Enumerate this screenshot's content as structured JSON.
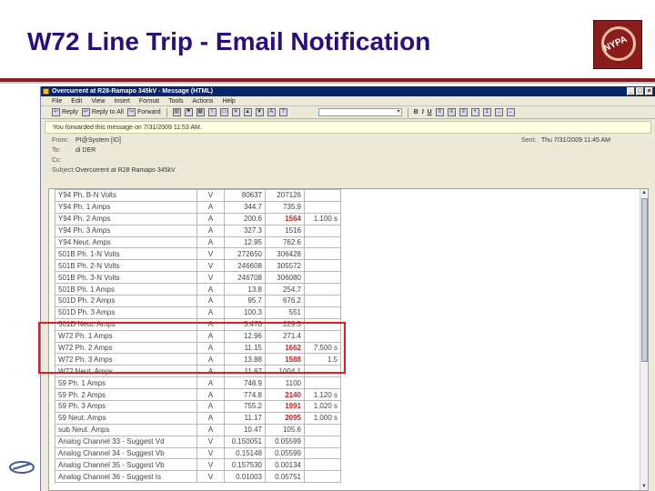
{
  "slide": {
    "title": "W72 Line Trip - Email Notification",
    "logo_text": "NYPA"
  },
  "window": {
    "title": "Overcurrent at R28-Ramapo 345kV - Message (HTML)"
  },
  "menu": [
    "File",
    "Edit",
    "View",
    "Insert",
    "Format",
    "Tools",
    "Actions",
    "Help"
  ],
  "toolbar": {
    "reply": "Reply",
    "reply_all": "Reply to All",
    "forward": "Forward"
  },
  "infobar": {
    "text": "You forwarded this message on 7/31/2009 11:53 AM."
  },
  "headers": {
    "from_label": "From:",
    "from_value": "PI@System [ID]",
    "to_label": "To:",
    "to_value": "di DER",
    "cc_label": "Cc:",
    "cc_value": "",
    "subject_label": "Subject:",
    "subject_value": "Overcurrent at R28 Ramapo 345kV",
    "sent_label": "Sent:",
    "sent_value": "Thu 7/31/2009 11:45 AM"
  },
  "table": {
    "rows": [
      {
        "name": "Y94 Ph. B-N Volts",
        "unit": "V",
        "v1": "80637",
        "v2": "207126",
        "v3": "",
        "red": false
      },
      {
        "name": "Y94 Ph. 1 Amps",
        "unit": "A",
        "v1": "344.7",
        "v2": "735.9",
        "v3": "",
        "red": false
      },
      {
        "name": "Y94 Ph. 2 Amps",
        "unit": "A",
        "v1": "200.6",
        "v2": "1564",
        "v3": "1.100 s",
        "red": true
      },
      {
        "name": "Y94 Ph. 3 Amps",
        "unit": "A",
        "v1": "327.3",
        "v2": "1516",
        "v3": "",
        "red": false
      },
      {
        "name": "Y94 Neut. Amps",
        "unit": "A",
        "v1": "12.95",
        "v2": "762.6",
        "v3": "",
        "red": false
      },
      {
        "name": "501B Ph. 1-N Volts",
        "unit": "V",
        "v1": "272650",
        "v2": "306428",
        "v3": "",
        "red": false
      },
      {
        "name": "501B Ph. 2-N Volts",
        "unit": "V",
        "v1": "246608",
        "v2": "305572",
        "v3": "",
        "red": false
      },
      {
        "name": "501B Ph. 3-N Volts",
        "unit": "V",
        "v1": "246708",
        "v2": "306080",
        "v3": "",
        "red": false
      },
      {
        "name": "501B Ph. 1 Amps",
        "unit": "A",
        "v1": "13.8",
        "v2": "254.7",
        "v3": "",
        "red": false
      },
      {
        "name": "501D Ph. 2 Amps",
        "unit": "A",
        "v1": "95.7",
        "v2": "676.2",
        "v3": "",
        "red": false
      },
      {
        "name": "501D Ph. 3 Amps",
        "unit": "A",
        "v1": "100.3",
        "v2": "551",
        "v3": "",
        "red": false
      },
      {
        "name": "501D Neut. Amps",
        "unit": "A",
        "v1": "5.470",
        "v2": "229.5",
        "v3": "",
        "red": false
      },
      {
        "name": "W72 Ph. 1 Amps",
        "unit": "A",
        "v1": "12.96",
        "v2": "271.4",
        "v3": "",
        "red": false
      },
      {
        "name": "W72 Ph. 2 Amps",
        "unit": "A",
        "v1": "11.15",
        "v2": "1662",
        "v3": "7.500 s",
        "red": true
      },
      {
        "name": "W72 Ph. 3 Amps",
        "unit": "A",
        "v1": "13.88",
        "v2": "1588",
        "v3": "1.5",
        "red": true
      },
      {
        "name": "W72 Neut. Amps",
        "unit": "A",
        "v1": "11.67",
        "v2": "1004.1",
        "v3": "",
        "red": false
      },
      {
        "name": "59 Ph. 1 Amps",
        "unit": "A",
        "v1": "748.9",
        "v2": "1100",
        "v3": "",
        "red": false
      },
      {
        "name": "59 Ph. 2 Amps",
        "unit": "A",
        "v1": "774.8",
        "v2": "2140",
        "v3": "1.120 s",
        "red": true
      },
      {
        "name": "59 Ph. 3 Amps",
        "unit": "A",
        "v1": "755.2",
        "v2": "1991",
        "v3": "1.020 s",
        "red": true
      },
      {
        "name": "59 Neut. Amps",
        "unit": "A",
        "v1": "11.17",
        "v2": "2095",
        "v3": "1.000 s",
        "red": true
      },
      {
        "name": "sub Neut. Amps",
        "unit": "A",
        "v1": "10.47",
        "v2": "105.6",
        "v3": "",
        "red": false
      },
      {
        "name": "Analog Channel 33 - Suggest Vd",
        "unit": "V",
        "v1": "0.150051",
        "v2": "0.05599",
        "v3": "",
        "red": false
      },
      {
        "name": "Analog Channel 34 - Suggest Vb",
        "unit": "V",
        "v1": "0.15148",
        "v2": "0.05599",
        "v3": "",
        "red": false
      },
      {
        "name": "Analog Channel 35 - Suggest Vb",
        "unit": "V",
        "v1": "0.157530",
        "v2": "0.00134",
        "v3": "",
        "red": false
      },
      {
        "name": "Analog Channel 36 - Suggest Is",
        "unit": "V",
        "v1": "0.01003",
        "v2": "0.05751",
        "v3": "",
        "red": false
      }
    ]
  }
}
